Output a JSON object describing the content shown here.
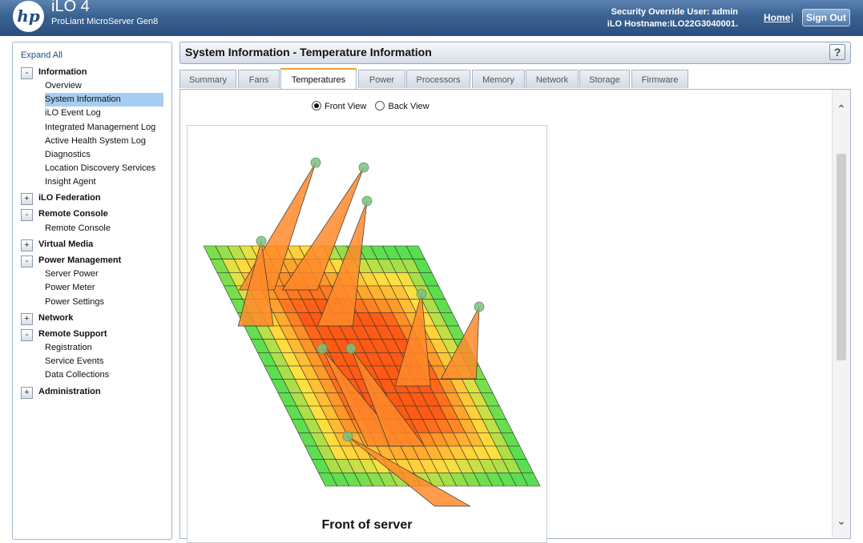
{
  "header": {
    "logo_text": "hp",
    "title": "iLO 4",
    "subtitle": "ProLiant MicroServer Gen8",
    "security_override": "Security Override User:  admin",
    "hostname": "iLO Hostname:ILO22G3040001.",
    "home_link": "Home",
    "separator": "|",
    "sign_out": "Sign Out"
  },
  "nav": {
    "expand_all": "Expand All",
    "groups": [
      {
        "toggle": "-",
        "label": "Information",
        "items": [
          "Overview",
          "System Information",
          "iLO Event Log",
          "Integrated Management Log",
          "Active Health System Log",
          "Diagnostics",
          "Location Discovery Services",
          "Insight Agent"
        ]
      },
      {
        "toggle": "+",
        "label": "iLO Federation",
        "items": []
      },
      {
        "toggle": "-",
        "label": "Remote Console",
        "items": [
          "Remote Console"
        ]
      },
      {
        "toggle": "+",
        "label": "Virtual Media",
        "items": []
      },
      {
        "toggle": "-",
        "label": "Power Management",
        "items": [
          "Server Power",
          "Power Meter",
          "Power Settings"
        ]
      },
      {
        "toggle": "+",
        "label": "Network",
        "items": []
      },
      {
        "toggle": "-",
        "label": "Remote Support",
        "items": [
          "Registration",
          "Service Events",
          "Data Collections"
        ]
      },
      {
        "toggle": "+",
        "label": "Administration",
        "items": []
      }
    ],
    "selected_item": "System Information"
  },
  "panel": {
    "title": "System Information - Temperature Information",
    "help": "?"
  },
  "tabs": [
    "Summary",
    "Fans",
    "Temperatures",
    "Power",
    "Processors",
    "Memory",
    "Network",
    "Storage",
    "Firmware"
  ],
  "active_tab": "Temperatures",
  "view_options": {
    "front": "Front View",
    "back": "Back View",
    "selected": "Front View"
  },
  "map": {
    "caption": "Front of server"
  },
  "colors": {
    "header_dark": "#2b4f7e",
    "selected_nav": "#a6cdf2",
    "active_tab_accent": "#f0a030",
    "cool": "#33dd55",
    "warm": "#ffe040",
    "hot": "#ff5a14"
  }
}
